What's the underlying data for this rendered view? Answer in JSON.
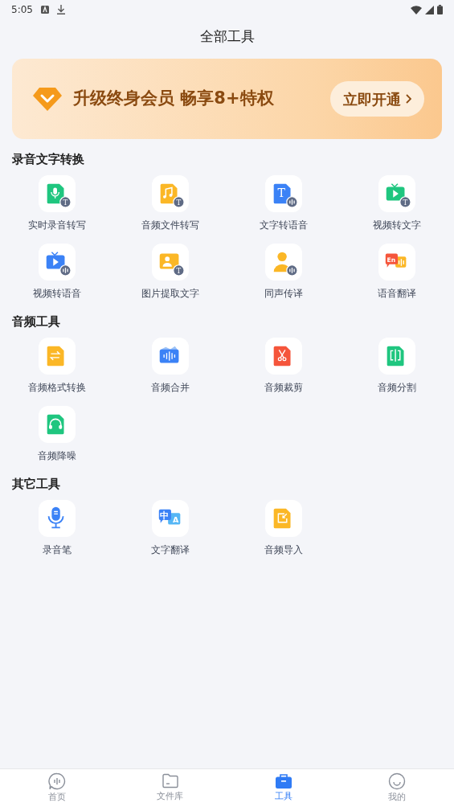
{
  "status_bar": {
    "time": "5:05"
  },
  "title": "全部工具",
  "banner": {
    "text": "升级终身会员 畅享8+特权",
    "button": "立即开通"
  },
  "sections": [
    {
      "title": "录音文字转换",
      "tools": [
        {
          "label": "实时录音转写",
          "kind": "mic-doc",
          "badge": "T"
        },
        {
          "label": "音频文件转写",
          "kind": "music-doc",
          "badge": "T"
        },
        {
          "label": "文字转语音",
          "kind": "text-doc",
          "icon_text": "T",
          "sound_badge": true
        },
        {
          "label": "视频转文字",
          "kind": "tv-green",
          "badge": "T"
        },
        {
          "label": "视频转语音",
          "kind": "tv-blue",
          "sound_badge": true
        },
        {
          "label": "图片提取文字",
          "kind": "image",
          "badge": "T"
        },
        {
          "label": "同声传译",
          "kind": "person",
          "sound_badge": true
        },
        {
          "label": "语音翻译",
          "kind": "en-bubble",
          "icon_text": "En"
        }
      ]
    },
    {
      "title": "音频工具",
      "tools": [
        {
          "label": "音频格式转换",
          "kind": "convert"
        },
        {
          "label": "音频合并",
          "kind": "merge"
        },
        {
          "label": "音频裁剪",
          "kind": "scissors"
        },
        {
          "label": "音频分割",
          "kind": "split"
        },
        {
          "label": "音频降噪",
          "kind": "headphones"
        }
      ]
    },
    {
      "title": "其它工具",
      "tools": [
        {
          "label": "录音笔",
          "kind": "microphone"
        },
        {
          "label": "文字翻译",
          "kind": "translate",
          "icon_text": "中",
          "icon_text_2": "A"
        },
        {
          "label": "音频导入",
          "kind": "import"
        }
      ]
    }
  ],
  "tabs": [
    {
      "label": "首页",
      "kind": "home",
      "selected": false
    },
    {
      "label": "文件库",
      "kind": "folder",
      "selected": false
    },
    {
      "label": "工具",
      "kind": "toolbox",
      "selected": true
    },
    {
      "label": "我的",
      "kind": "face",
      "selected": false
    }
  ]
}
